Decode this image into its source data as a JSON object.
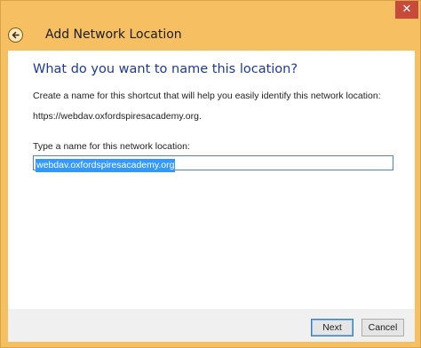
{
  "window": {
    "title": "Add Network Location",
    "close_glyph": "✕",
    "back_icon": "back-arrow-icon"
  },
  "main": {
    "heading": "What do you want to name this location?",
    "description": "Create a name for this shortcut that will help you easily identify this network location:",
    "url": "https://webdav.oxfordspiresacademy.org.",
    "field_label": "Type a name for this network location:",
    "name_value": "webdav.oxfordspiresacademy.org"
  },
  "footer": {
    "next_label": "Next",
    "cancel_label": "Cancel"
  },
  "colors": {
    "frame": "#f5bf62",
    "heading": "#1e3a9e",
    "selection": "#3399ff",
    "close": "#c74a3a"
  }
}
